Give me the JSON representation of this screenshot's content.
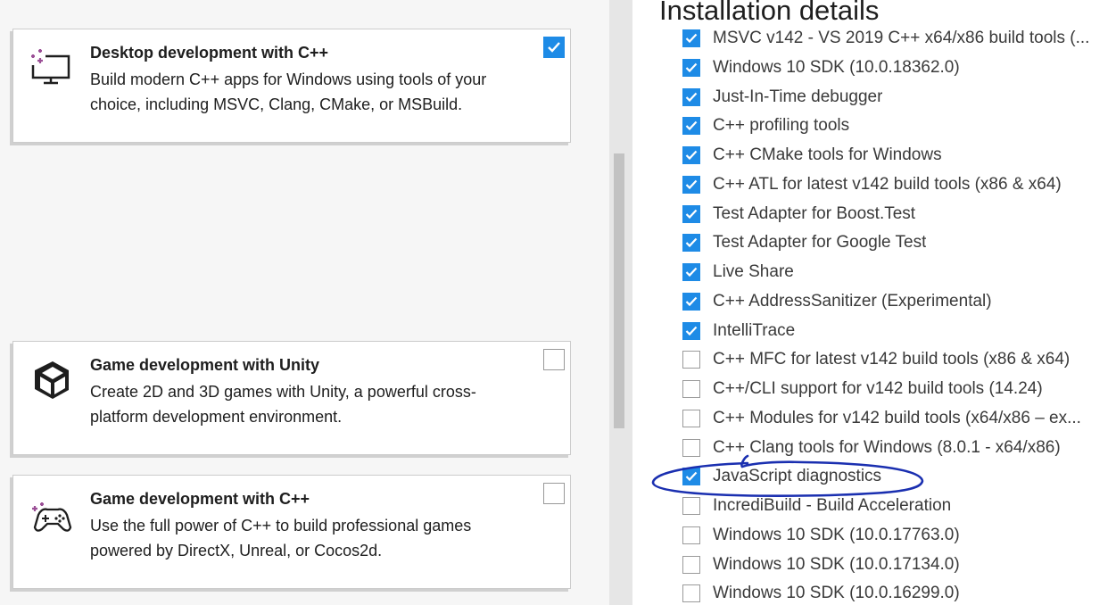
{
  "workloads": [
    {
      "title": "Desktop development with C++",
      "description": "Build modern C++ apps for Windows using tools of your choice, including MSVC, Clang, CMake, or MSBuild.",
      "icon": "desktop-monitor-icon",
      "checked": true
    },
    {
      "title": "Game development with Unity",
      "description": "Create 2D and 3D games with Unity, a powerful cross-platform development environment.",
      "icon": "unity-logo-icon",
      "checked": false
    },
    {
      "title": "Game development with C++",
      "description": "Use the full power of C++ to build professional games powered by DirectX, Unreal, or Cocos2d.",
      "icon": "gamepad-icon",
      "checked": false
    }
  ],
  "details": {
    "title": "Installation details",
    "components": [
      {
        "label": "MSVC v142 - VS 2019 C++ x64/x86 build tools (...",
        "checked": true
      },
      {
        "label": "Windows 10 SDK (10.0.18362.0)",
        "checked": true
      },
      {
        "label": "Just-In-Time debugger",
        "checked": true
      },
      {
        "label": "C++ profiling tools",
        "checked": true
      },
      {
        "label": "C++ CMake tools for Windows",
        "checked": true
      },
      {
        "label": "C++ ATL for latest v142 build tools (x86 & x64)",
        "checked": true
      },
      {
        "label": "Test Adapter for Boost.Test",
        "checked": true
      },
      {
        "label": "Test Adapter for Google Test",
        "checked": true
      },
      {
        "label": "Live Share",
        "checked": true
      },
      {
        "label": "C++ AddressSanitizer (Experimental)",
        "checked": true
      },
      {
        "label": "IntelliTrace",
        "checked": true
      },
      {
        "label": "C++ MFC for latest v142 build tools (x86 & x64)",
        "checked": false
      },
      {
        "label": "C++/CLI support for v142 build tools (14.24)",
        "checked": false
      },
      {
        "label": "C++ Modules for v142 build tools (x64/x86 – ex...",
        "checked": false
      },
      {
        "label": "C++ Clang tools for Windows (8.0.1 - x64/x86)",
        "checked": false
      },
      {
        "label": "JavaScript diagnostics",
        "checked": true
      },
      {
        "label": "IncrediBuild - Build Acceleration",
        "checked": false
      },
      {
        "label": "Windows 10 SDK (10.0.17763.0)",
        "checked": false
      },
      {
        "label": "Windows 10 SDK (10.0.17134.0)",
        "checked": false
      },
      {
        "label": "Windows 10 SDK (10.0.16299.0)",
        "checked": false
      }
    ]
  },
  "colors": {
    "accent": "#1e8be6",
    "icon_purple": "#9b4f96",
    "annotation_ink": "#1a2fb0"
  }
}
